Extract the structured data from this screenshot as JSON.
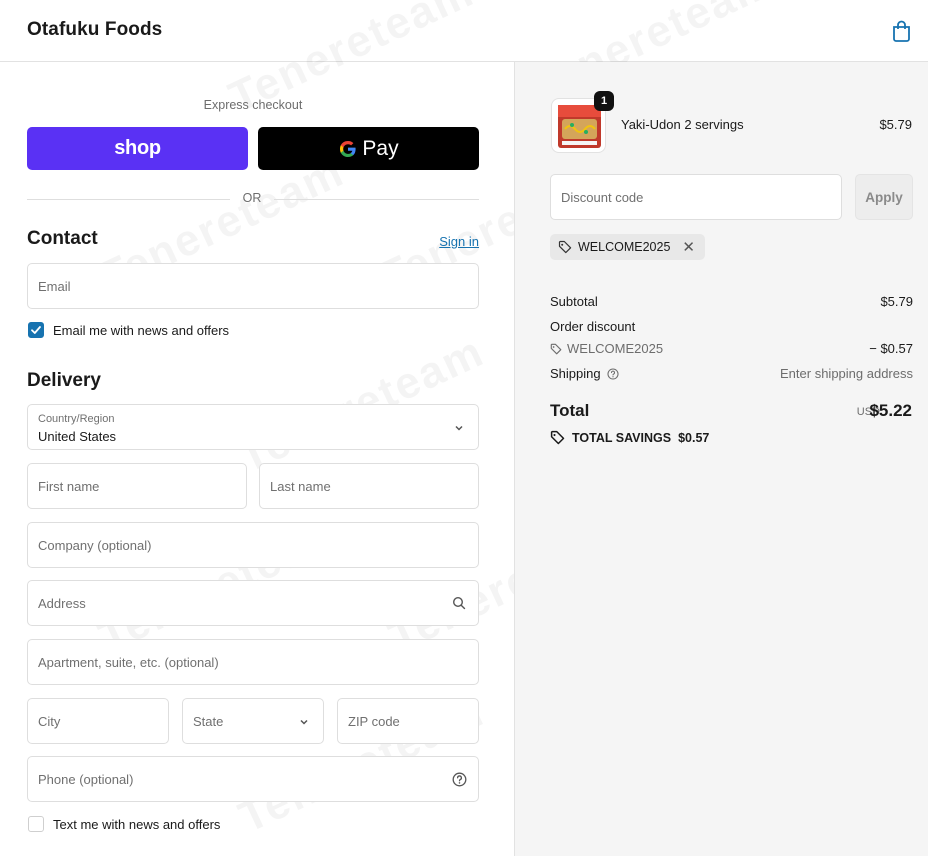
{
  "header": {
    "store_name": "Otafuku Foods",
    "cart_icon": "shopping-bag-icon"
  },
  "express": {
    "label": "Express checkout",
    "shop_label": "shop",
    "gpay_label": "Pay",
    "or_label": "OR"
  },
  "contact": {
    "title": "Contact",
    "sign_in": "Sign in",
    "email_placeholder": "Email",
    "news_label": "Email me with news and offers",
    "news_checked": true
  },
  "delivery": {
    "title": "Delivery",
    "country_label": "Country/Region",
    "country_value": "United States",
    "first_name": "First name",
    "last_name": "Last name",
    "company": "Company (optional)",
    "address": "Address",
    "apartment": "Apartment, suite, etc. (optional)",
    "city": "City",
    "state": "State",
    "zip": "ZIP code",
    "phone": "Phone (optional)",
    "sms_label": "Text me with news and offers",
    "sms_checked": false
  },
  "summary": {
    "item": {
      "name": "Yaki-Udon 2 servings",
      "price": "$5.79",
      "qty": "1"
    },
    "discount_placeholder": "Discount code",
    "apply_label": "Apply",
    "applied_code": "WELCOME2025",
    "subtotal_label": "Subtotal",
    "subtotal_value": "$5.79",
    "order_discount_label": "Order discount",
    "discount_code": "WELCOME2025",
    "discount_value": "− $0.57",
    "shipping_label": "Shipping",
    "shipping_value": "Enter shipping address",
    "total_label": "Total",
    "currency": "USD",
    "total_value": "$5.22",
    "savings_label": "TOTAL SAVINGS",
    "savings_value": "$0.57"
  },
  "watermark": "Tenereteam",
  "colors": {
    "shop_purple": "#5a31f4",
    "link_blue": "#1773b0",
    "summary_bg": "#f5f5f5"
  }
}
